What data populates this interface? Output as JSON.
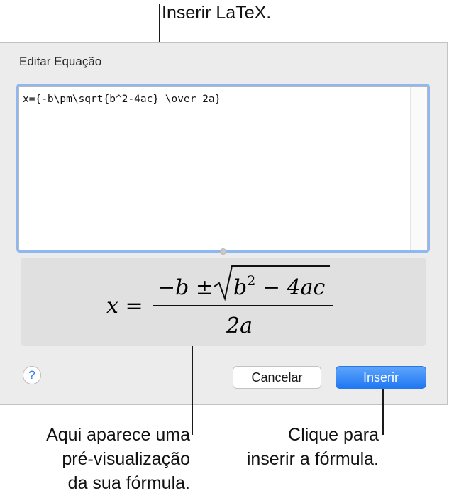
{
  "callouts": {
    "top": "Inserir LaTeX.",
    "preview_lines": [
      "Aqui aparece uma",
      "pré-visualização",
      "da sua fórmula."
    ],
    "insert_lines": [
      "Clique para",
      "inserir a fórmula."
    ]
  },
  "dialog": {
    "title": "Editar Equação",
    "latex_input": "x={-b\\pm\\sqrt{b^2-4ac} \\over 2a}",
    "preview": {
      "lhs": "x =",
      "numerator": "−b ± ",
      "radicand_base": "b",
      "radicand_exp": "2",
      "radicand_rest": " − 4ac",
      "denominator": "2a"
    },
    "help_label": "?",
    "cancel_label": "Cancelar",
    "insert_label": "Inserir"
  },
  "colors": {
    "accent": "#1f78f2",
    "focus_ring": "#8fb8f2",
    "dialog_bg": "#ececec"
  },
  "icons": {
    "help": "question-mark-icon"
  }
}
